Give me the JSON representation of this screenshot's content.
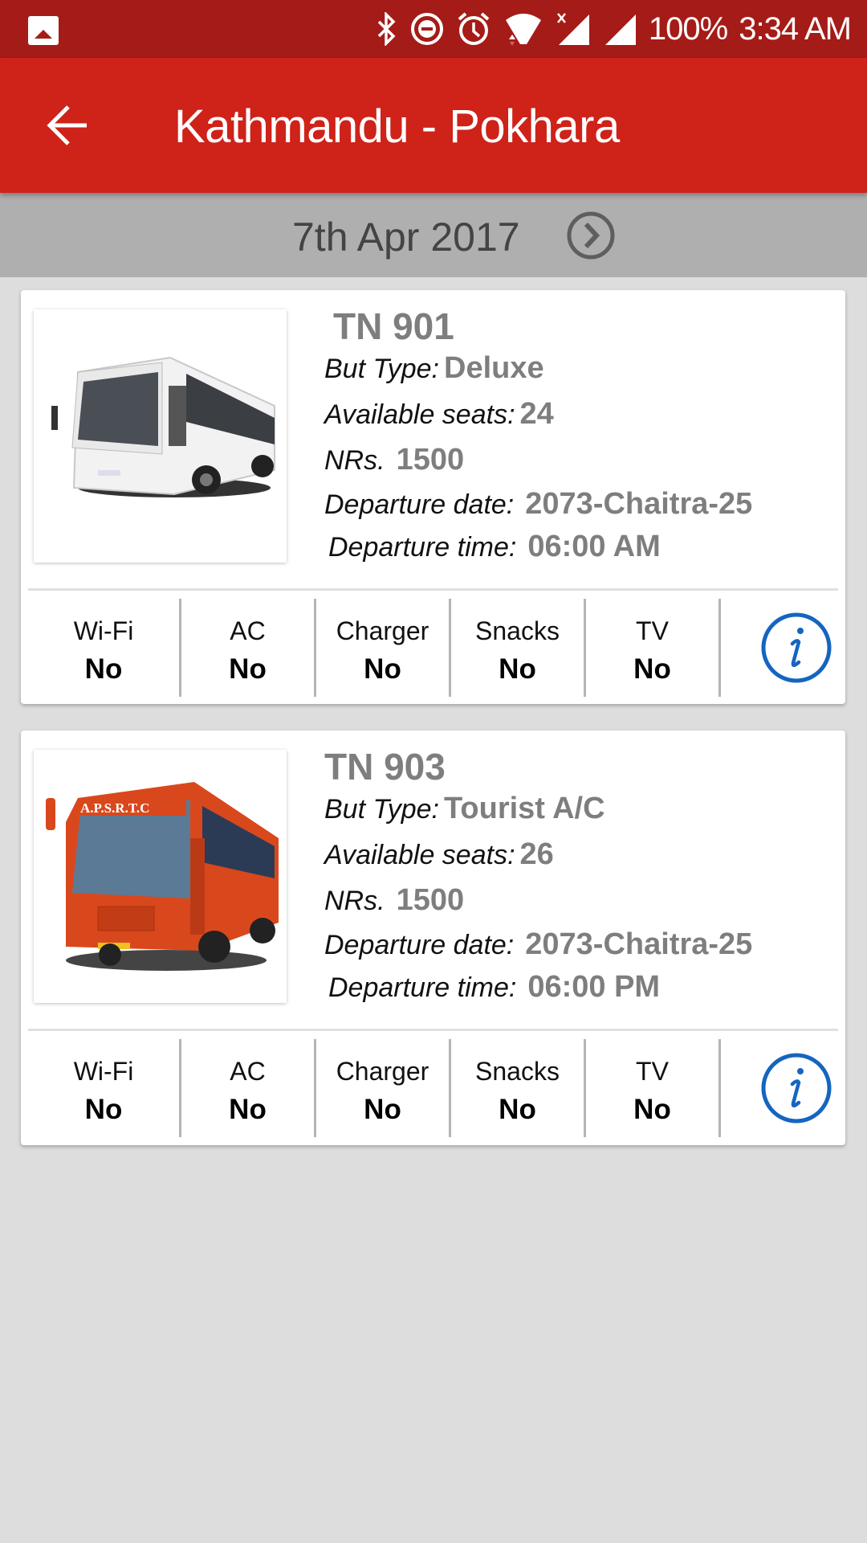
{
  "status_bar": {
    "battery": "100%",
    "time": "3:34 AM",
    "icons": [
      "gallery-icon",
      "bluetooth-icon",
      "do-not-disturb-icon",
      "alarm-icon",
      "wifi-icon",
      "signal-no-sim-icon",
      "signal-icon"
    ]
  },
  "toolbar": {
    "back_icon": "arrow-back-icon",
    "title": "Kathmandu - Pokhara"
  },
  "date_bar": {
    "date": "7th Apr 2017",
    "next_icon": "chevron-right-circle-icon"
  },
  "colors": {
    "status_bar": "#a51b17",
    "toolbar": "#cf2219",
    "date_bar": "#afafaf",
    "background": "#dddddd",
    "value_gray": "#7e7e7e",
    "info_blue": "#1565c0"
  },
  "labels": {
    "bus_type": "But Type:",
    "seats": "Available seats:",
    "price": "NRs.",
    "departure_date": "Departure date:",
    "departure_time": "Departure time:"
  },
  "buses": [
    {
      "name": "TN 901",
      "image": "white-coach-bus",
      "bus_type": "Deluxe",
      "seats": "24",
      "price": "1500",
      "departure_date": "2073-Chaitra-25",
      "departure_time": "06:00 AM",
      "amenities": [
        {
          "label": "Wi-Fi",
          "value": "No"
        },
        {
          "label": "AC",
          "value": "No"
        },
        {
          "label": "Charger",
          "value": "No"
        },
        {
          "label": "Snacks",
          "value": "No"
        },
        {
          "label": "TV",
          "value": "No"
        }
      ]
    },
    {
      "name": "TN 903",
      "image": "orange-apsrtc-bus",
      "bus_logo_text": "A.P.S.R.T.C",
      "bus_type": "Tourist A/C",
      "seats": "26",
      "price": "1500",
      "departure_date": "2073-Chaitra-25",
      "departure_time": "06:00 PM",
      "amenities": [
        {
          "label": "Wi-Fi",
          "value": "No"
        },
        {
          "label": "AC",
          "value": "No"
        },
        {
          "label": "Charger",
          "value": "No"
        },
        {
          "label": "Snacks",
          "value": "No"
        },
        {
          "label": "TV",
          "value": "No"
        }
      ]
    }
  ]
}
